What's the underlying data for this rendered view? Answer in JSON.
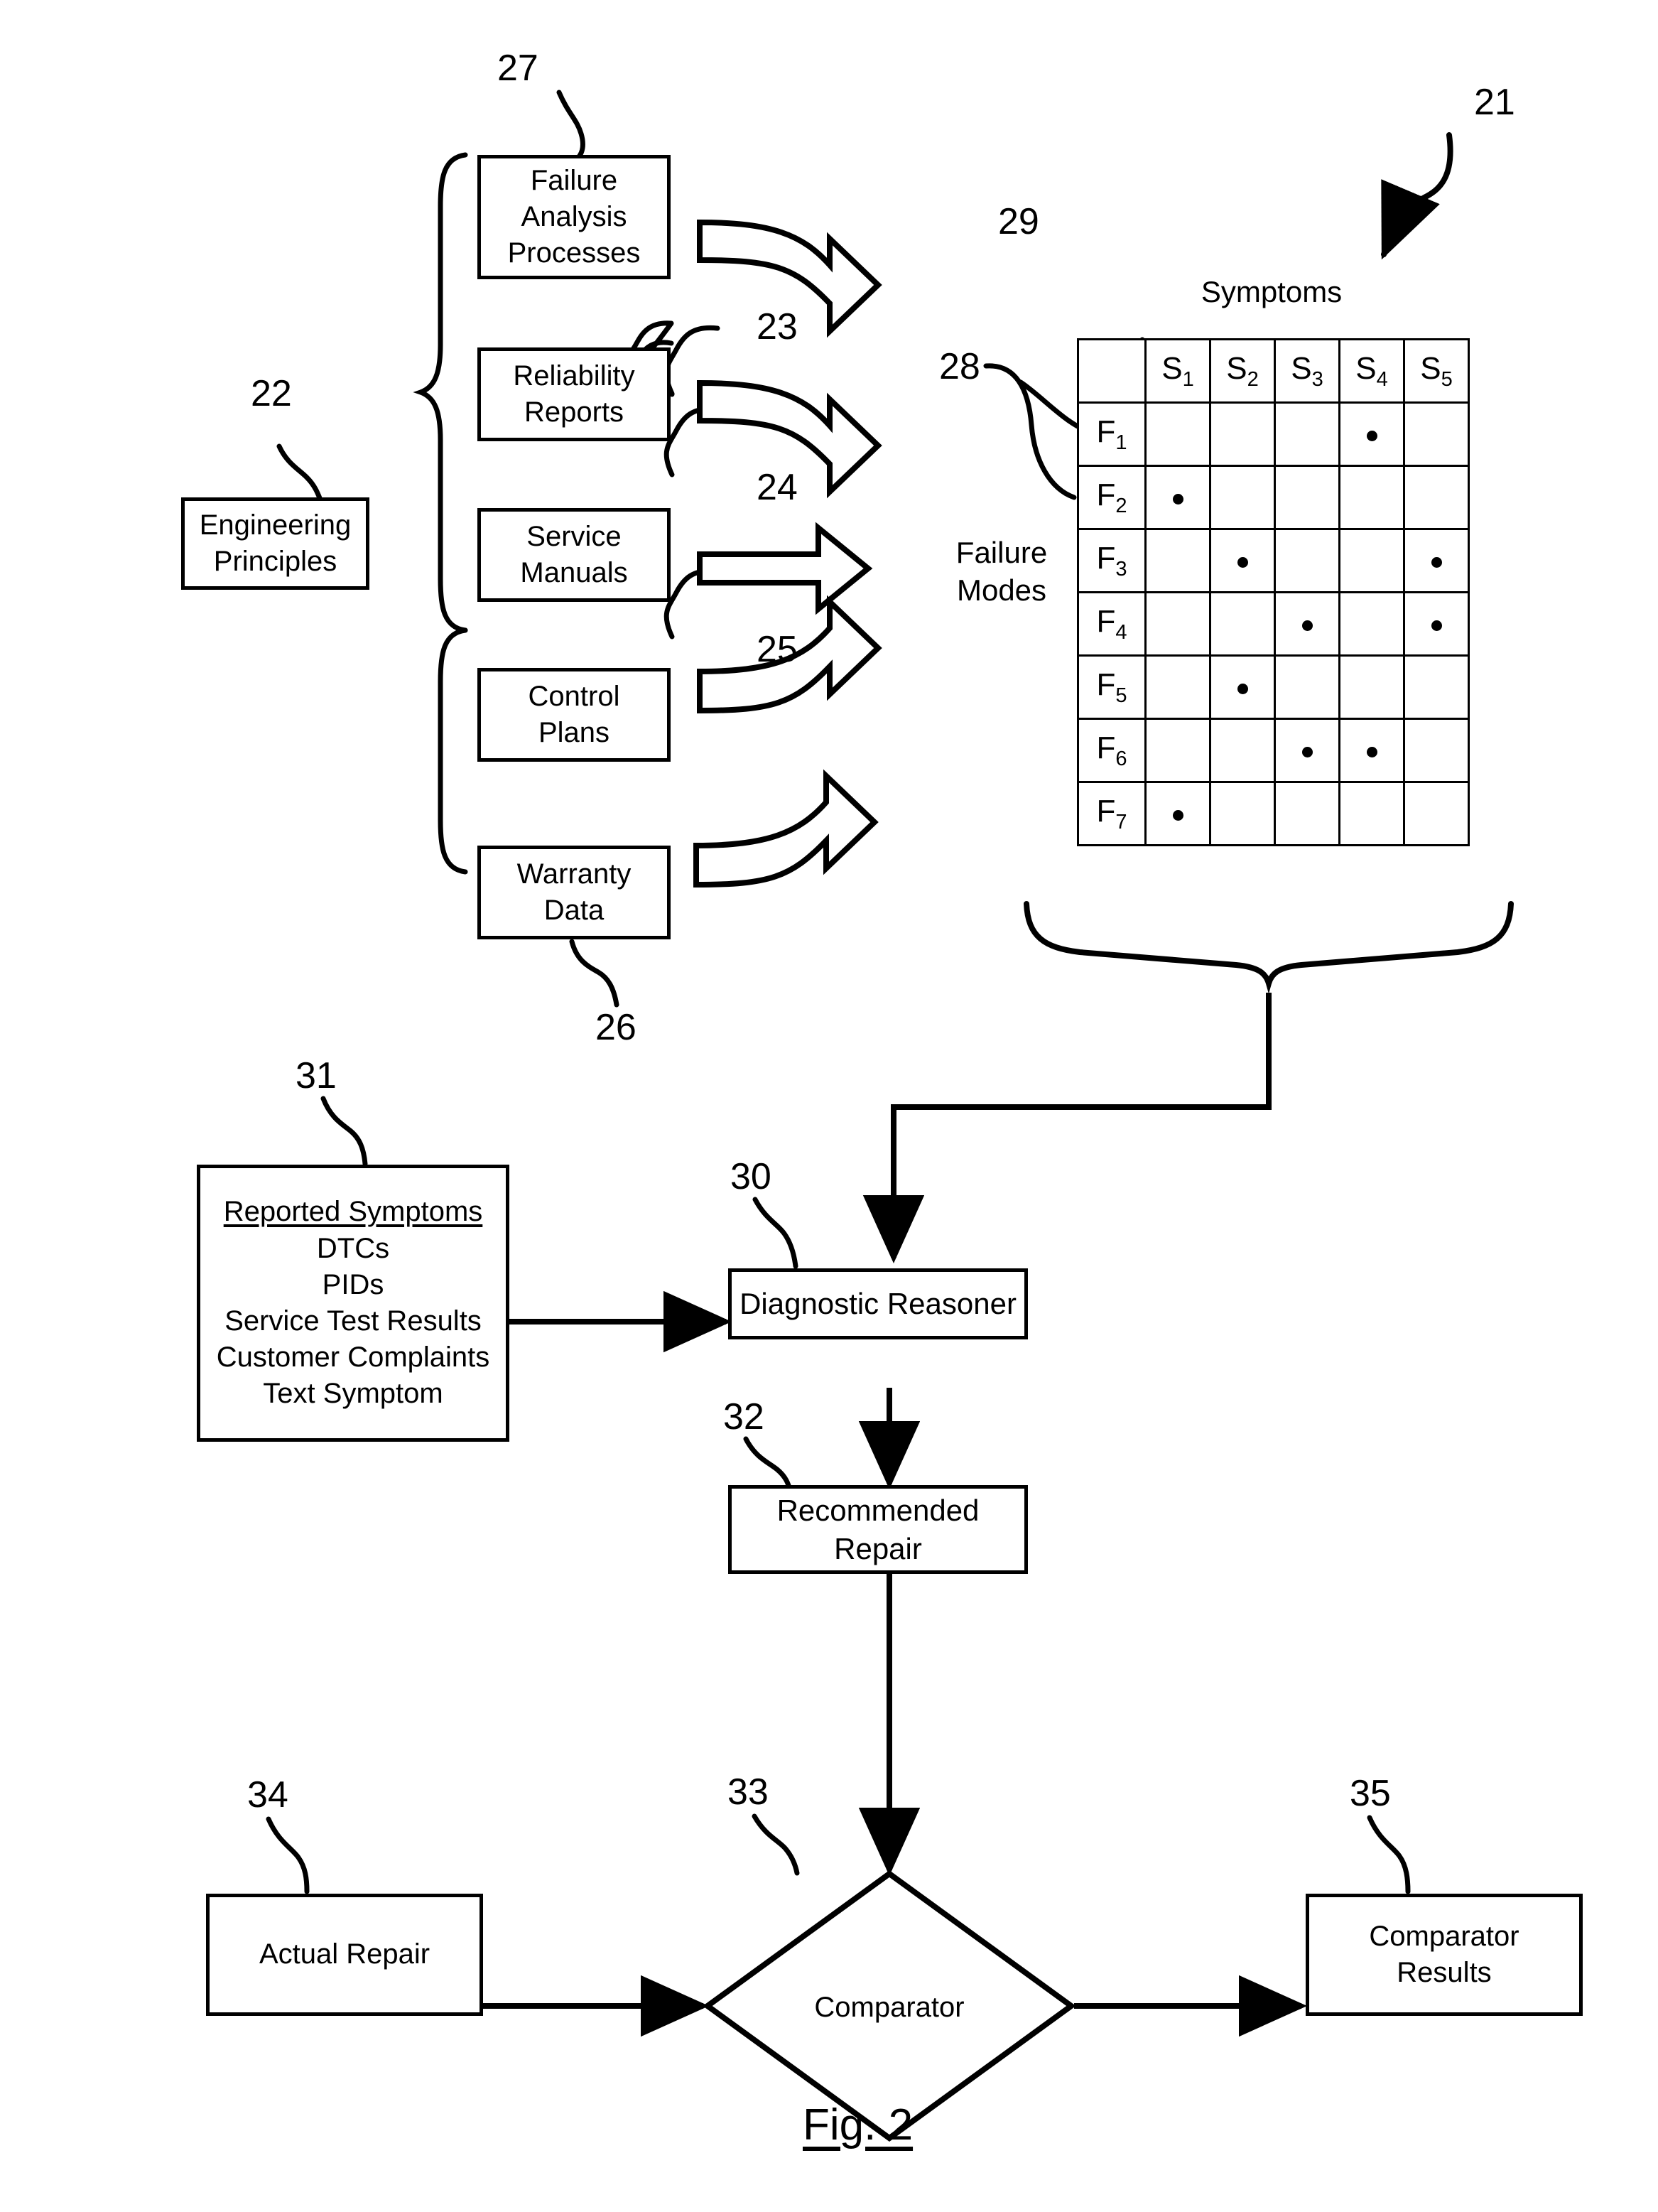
{
  "figure": {
    "caption": "Fig. 2"
  },
  "ref_numbers": {
    "n21": "21",
    "n22": "22",
    "n23": "23",
    "n24": "24",
    "n25": "25",
    "n26": "26",
    "n27": "27",
    "n28": "28",
    "n29": "29",
    "n30": "30",
    "n31": "31",
    "n32": "32",
    "n33": "33",
    "n34": "34",
    "n35": "35"
  },
  "nodes": {
    "engineering_principles": "Engineering\nPrinciples",
    "failure_analysis_processes": "Failure\nAnalysis\nProcesses",
    "reliability_reports": "Reliability\nReports",
    "service_manuals": "Service\nManuals",
    "control_plans": "Control\nPlans",
    "warranty_data": "Warranty\nData",
    "diagnostic_reasoner": "Diagnostic Reasoner",
    "recommended_repair": "Recommended\nRepair",
    "actual_repair": "Actual Repair",
    "comparator": "Comparator",
    "comparator_results": "Comparator\nResults"
  },
  "reported_symptoms": {
    "title": "Reported Symptoms",
    "items": [
      "DTCs",
      "PIDs",
      "Service Test Results",
      "Customer Complaints",
      "Text Symptom"
    ]
  },
  "matrix": {
    "col_axis_label": "Symptoms",
    "row_axis_label": "Failure\nModes",
    "corner": "",
    "columns": [
      {
        "base": "S",
        "sub": "1"
      },
      {
        "base": "S",
        "sub": "2"
      },
      {
        "base": "S",
        "sub": "3"
      },
      {
        "base": "S",
        "sub": "4"
      },
      {
        "base": "S",
        "sub": "5"
      }
    ],
    "rows": [
      {
        "base": "F",
        "sub": "1",
        "marks": [
          false,
          false,
          false,
          true,
          false
        ]
      },
      {
        "base": "F",
        "sub": "2",
        "marks": [
          true,
          false,
          false,
          false,
          false
        ]
      },
      {
        "base": "F",
        "sub": "3",
        "marks": [
          false,
          true,
          false,
          false,
          true
        ]
      },
      {
        "base": "F",
        "sub": "4",
        "marks": [
          false,
          false,
          true,
          false,
          true
        ]
      },
      {
        "base": "F",
        "sub": "5",
        "marks": [
          false,
          true,
          false,
          false,
          false
        ]
      },
      {
        "base": "F",
        "sub": "6",
        "marks": [
          false,
          false,
          true,
          true,
          false
        ]
      },
      {
        "base": "F",
        "sub": "7",
        "marks": [
          true,
          false,
          false,
          false,
          false
        ]
      }
    ]
  },
  "colors": {
    "ink": "#000000",
    "paper": "#ffffff"
  }
}
